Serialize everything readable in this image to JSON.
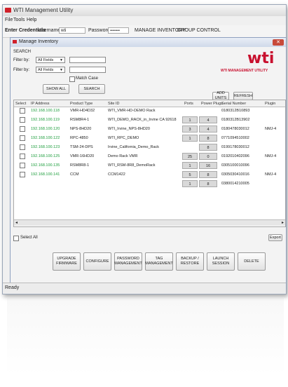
{
  "window": {
    "title": "WTI Management Utility"
  },
  "menu": [
    "File",
    "Tools",
    "Help"
  ],
  "credentials": {
    "label": "Enter Credentials",
    "username_label": "Username:",
    "username_value": "wti",
    "password_label": "Password:",
    "password_value": "••••••••",
    "nav_inventory": "MANAGE INVENTORY",
    "nav_group": "GROUP CONTROL"
  },
  "inner_window": {
    "title": "Manage Inventory"
  },
  "search": {
    "heading": "SEARCH",
    "filter1_label": "Filter by:",
    "filter1_value": "All Fields",
    "filter2_label": "Filter by:",
    "filter2_value": "All Fields",
    "match_case": "Match Case",
    "show_all": "SHOW ALL",
    "search": "SEARCH"
  },
  "brand": {
    "logo": "wti",
    "tag": "WTI MANAGEMENT UTILITY"
  },
  "buttons": {
    "add_units": "ADD UNITS",
    "refresh": "REFRESH",
    "export": "Export",
    "select_all": "Select All"
  },
  "table": {
    "headers": [
      "Select",
      "IP Address",
      "Product Type",
      "Site ID",
      "Ports",
      "Power Plugs",
      "Serial Number",
      "Plugin"
    ],
    "rows": [
      {
        "ip": "192.168.100.118",
        "product": "VMR-HD4D32",
        "site": "WTI_VMR-HD-DEMO Rack",
        "ports": "",
        "plugs": "",
        "serial": "0180312B10893",
        "plugin": ""
      },
      {
        "ip": "192.168.100.119",
        "product": "RSM8R4-1",
        "site": "WTI_DEMO_RACK_in_Irvine CA 92618",
        "ports": "1",
        "plugs": "4",
        "serial": "0180312B13902",
        "plugin": ""
      },
      {
        "ip": "192.168.100.120",
        "product": "NPS-8HD20",
        "site": "WTI_Irvine_NPS-8HD20",
        "ports": "3",
        "plugs": "4",
        "serial": "0180478030012",
        "plugin": "NMJ-4"
      },
      {
        "ip": "192.168.100.122",
        "product": "RPC-4850",
        "site": "WTI_RPC_DEMO",
        "ports": "1",
        "plugs": "8",
        "serial": "0771094510002",
        "plugin": ""
      },
      {
        "ip": "192.168.100.123",
        "product": "TSM-24-DPS",
        "site": "Irvine_California_Demo_Rack",
        "ports": "",
        "plugs": "8",
        "serial": "0199178030012",
        "plugin": ""
      },
      {
        "ip": "192.168.100.125",
        "product": "VMR-16HD20",
        "site": "Demo Rack VMR",
        "ports": "25",
        "plugs": "0",
        "serial": "0192010402096",
        "plugin": "NMJ-4"
      },
      {
        "ip": "192.168.100.135",
        "product": "RSM8R8-1",
        "site": "WTI_RSM-8R8_DemoRack",
        "ports": "1",
        "plugs": "16",
        "serial": "0305100010096",
        "plugin": ""
      },
      {
        "ip": "192.168.100.141",
        "product": "CCM",
        "site": "CCM1422",
        "ports": "5",
        "plugs": "8",
        "serial": "0305030410016",
        "plugin": "NMJ-4"
      },
      {
        "ip": "",
        "product": "",
        "site": "",
        "ports": "1",
        "plugs": "8",
        "serial": "0380014210005",
        "plugin": ""
      }
    ]
  },
  "actions": [
    "UPGRADE FIRMWARE",
    "CONFIGURE",
    "PASSWORD MANAGEMENT",
    "TAG MANAGEMENT",
    "BACKUP / RESTORE",
    "LAUNCH SESSION",
    "DELETE"
  ],
  "status": "Ready"
}
